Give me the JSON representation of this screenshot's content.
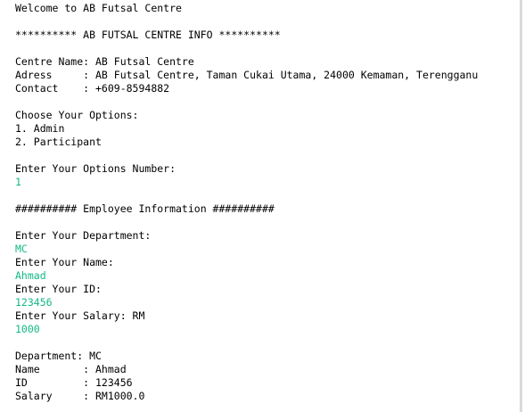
{
  "console": {
    "input_color": "#12b886",
    "lines": [
      {
        "text": "Welcome to AB Futsal Centre",
        "type": "output"
      },
      {
        "text": "",
        "type": "blank"
      },
      {
        "text": "********** AB FUTSAL CENTRE INFO **********",
        "type": "output"
      },
      {
        "text": "",
        "type": "blank"
      },
      {
        "text": "Centre Name: AB Futsal Centre",
        "type": "output"
      },
      {
        "text": "Adress     : AB Futsal Centre, Taman Cukai Utama, 24000 Kemaman, Terengganu",
        "type": "output"
      },
      {
        "text": "Contact    : +609-8594882",
        "type": "output"
      },
      {
        "text": "",
        "type": "blank"
      },
      {
        "text": "Choose Your Options:",
        "type": "output"
      },
      {
        "text": "1. Admin",
        "type": "output"
      },
      {
        "text": "2. Participant",
        "type": "output"
      },
      {
        "text": "",
        "type": "blank"
      },
      {
        "text": "Enter Your Options Number:",
        "type": "output"
      },
      {
        "text": "1",
        "type": "input"
      },
      {
        "text": "",
        "type": "blank"
      },
      {
        "text": "########## Employee Information ##########",
        "type": "output"
      },
      {
        "text": "",
        "type": "blank"
      },
      {
        "text": "Enter Your Department:",
        "type": "output"
      },
      {
        "text": "MC",
        "type": "input"
      },
      {
        "text": "Enter Your Name:",
        "type": "output"
      },
      {
        "text": "Ahmad",
        "type": "input"
      },
      {
        "text": "Enter Your ID:",
        "type": "output"
      },
      {
        "text": "123456",
        "type": "input"
      },
      {
        "text": "Enter Your Salary: RM",
        "type": "output"
      },
      {
        "text": "1000",
        "type": "input"
      },
      {
        "text": "",
        "type": "blank"
      },
      {
        "text": "Department: MC",
        "type": "output"
      },
      {
        "text": "Name       : Ahmad",
        "type": "output"
      },
      {
        "text": "ID         : 123456",
        "type": "output"
      },
      {
        "text": "Salary     : RM1000.0",
        "type": "output"
      }
    ]
  }
}
